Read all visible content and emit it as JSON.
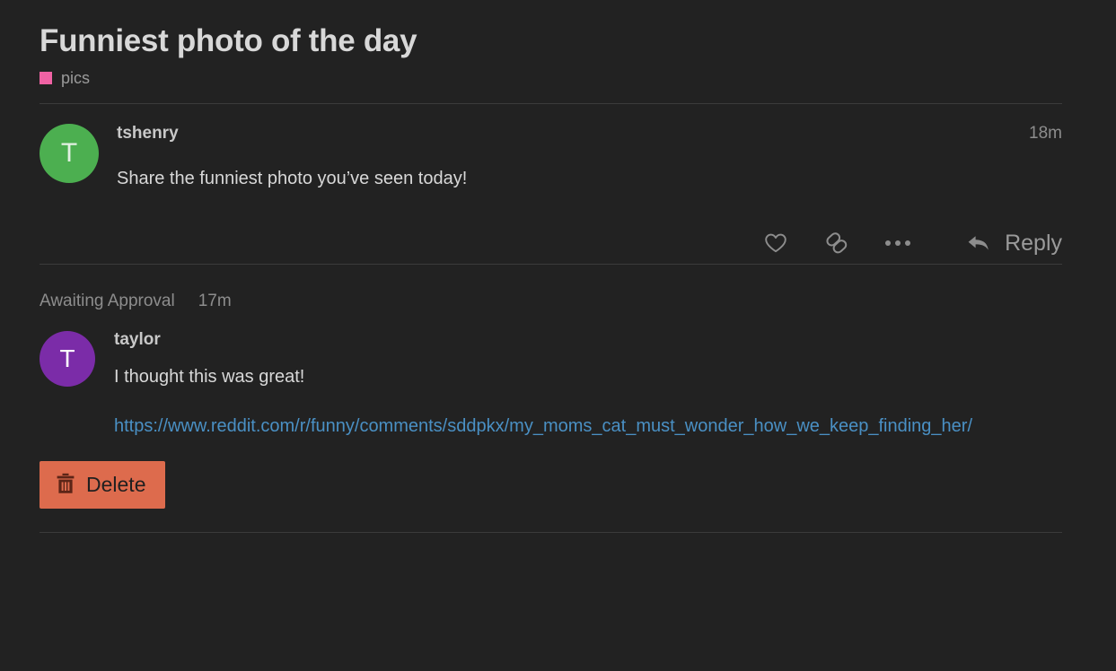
{
  "header": {
    "title": "Funniest photo of the day",
    "tag": {
      "label": "pics",
      "color": "#f062a4",
      "swatch_icon": "color-swatch-icon"
    }
  },
  "comments": [
    {
      "author": "tshenry",
      "avatar_initial": "T",
      "avatar_color": "#4caf50",
      "timestamp": "18m",
      "text": "Share the funniest photo you’ve seen today!",
      "actions": {
        "like_icon": "heart-icon",
        "link_icon": "chain-link-icon",
        "more_icon": "ellipsis-icon",
        "reply_icon": "reply-arrow-icon",
        "reply_label": "Reply"
      }
    }
  ],
  "pending_comment": {
    "status": "Awaiting Approval",
    "timestamp": "17m",
    "author": "taylor",
    "avatar_initial": "T",
    "avatar_color": "#7b2ca8",
    "text": "I thought this was great!",
    "link_url": "https://www.reddit.com/r/funny/comments/sddpkx/my_moms_cat_must_wonder_how_we_keep_finding_her/",
    "link_color": "#4a90c4",
    "delete_button": {
      "label": "Delete",
      "icon": "trash-icon",
      "background": "#dd6b4d"
    }
  }
}
